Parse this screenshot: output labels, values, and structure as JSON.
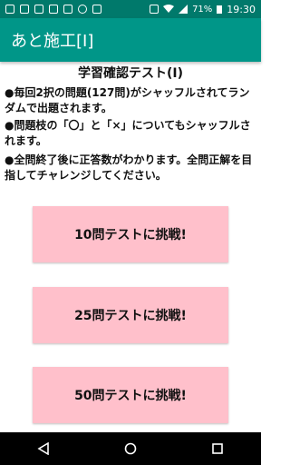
{
  "status_bar": {
    "battery": "71%",
    "time": "19:30",
    "icons": [
      "sd-icon",
      "battery-icon",
      "image-icon",
      "image-icon",
      "shirt-icon",
      "android-icon",
      "tools-icon",
      "nfc-icon",
      "wifi-icon",
      "signal-icon"
    ]
  },
  "app_bar": {
    "title": "あと施工[Ⅰ]"
  },
  "main": {
    "title": "学習確認テスト(Ⅰ)",
    "paragraphs": [
      "●毎回2択の問題(127問)がシャッフルされてランダムで出題されます。",
      "●問題枝の「〇」と「×」についてもシャッフルされます。",
      "●全問終了後に正答数がわかります。全問正解を目指してチャレンジしてください。"
    ],
    "buttons": [
      "10問テストに挑戦!",
      "25問テストに挑戦!",
      "50問テストに挑戦!"
    ]
  },
  "colors": {
    "status_bar": "#00796b",
    "app_bar": "#009688",
    "button": "#ffc0cb"
  }
}
